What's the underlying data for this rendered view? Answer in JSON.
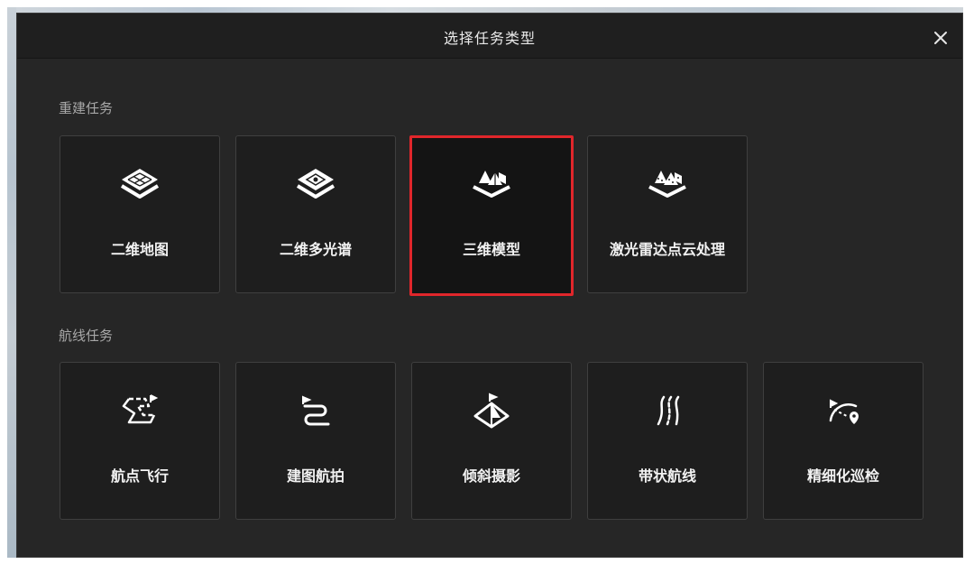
{
  "dialog": {
    "title": "选择任务类型",
    "close_icon": "close-icon"
  },
  "sections": [
    {
      "title": "重建任务",
      "cards": [
        {
          "label": "二维地图",
          "icon": "layers-icon",
          "selected": false
        },
        {
          "label": "二维多光谱",
          "icon": "multispectral-layers-icon",
          "selected": false
        },
        {
          "label": "三维模型",
          "icon": "3d-model-icon",
          "selected": true
        },
        {
          "label": "激光雷达点云处理",
          "icon": "lidar-pointcloud-icon",
          "selected": false
        }
      ]
    },
    {
      "title": "航线任务",
      "cards": [
        {
          "label": "航点飞行",
          "icon": "waypoint-flight-icon",
          "selected": false
        },
        {
          "label": "建图航拍",
          "icon": "mapping-route-icon",
          "selected": false
        },
        {
          "label": "倾斜摄影",
          "icon": "oblique-photography-icon",
          "selected": false
        },
        {
          "label": "带状航线",
          "icon": "corridor-route-icon",
          "selected": false
        },
        {
          "label": "精细化巡检",
          "icon": "fine-inspection-icon",
          "selected": false
        }
      ]
    }
  ],
  "colors": {
    "dialog_bg": "#262626",
    "card_bg": "#1e1e1e",
    "selected_border": "#e0262b",
    "text": "#f2f2f2"
  }
}
